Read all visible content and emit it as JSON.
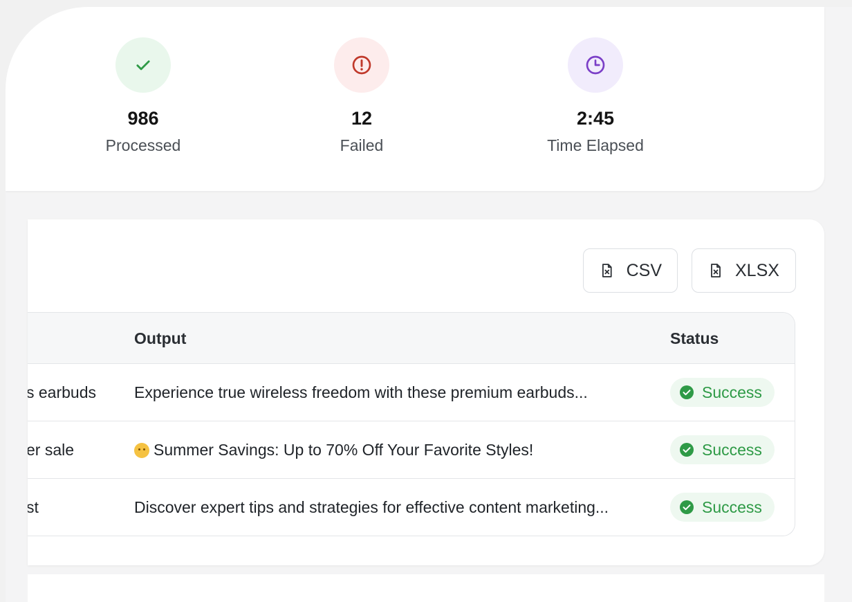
{
  "stats": {
    "processed": {
      "value": "986",
      "label": "Processed",
      "icon": "check-icon",
      "color": "#2e9a46"
    },
    "failed": {
      "value": "12",
      "label": "Failed",
      "icon": "alert-circle-icon",
      "color": "#c0392b"
    },
    "elapsed": {
      "value": "2:45",
      "label": "Time Elapsed",
      "icon": "clock-icon",
      "color": "#7b3fc7"
    }
  },
  "export": {
    "csv_label": "CSV",
    "xlsx_label": "XLSX",
    "icon": "file-spreadsheet-icon"
  },
  "table": {
    "headers": {
      "output": "Output",
      "status": "Status"
    },
    "rows": [
      {
        "input": "s earbuds",
        "output": "Experience true wireless freedom with these premium earbuds...",
        "status": "Success",
        "emoji": false
      },
      {
        "input": "er sale",
        "output": "Summer Savings: Up to 70% Off Your Favorite Styles!",
        "status": "Success",
        "emoji": true
      },
      {
        "input": "st",
        "output": "Discover expert tips and strategies for effective content marketing...",
        "status": "Success",
        "emoji": false
      }
    ]
  },
  "colors": {
    "success": "#2e9a46",
    "success_bg": "#eef8f0",
    "border": "#e3e5e8"
  }
}
